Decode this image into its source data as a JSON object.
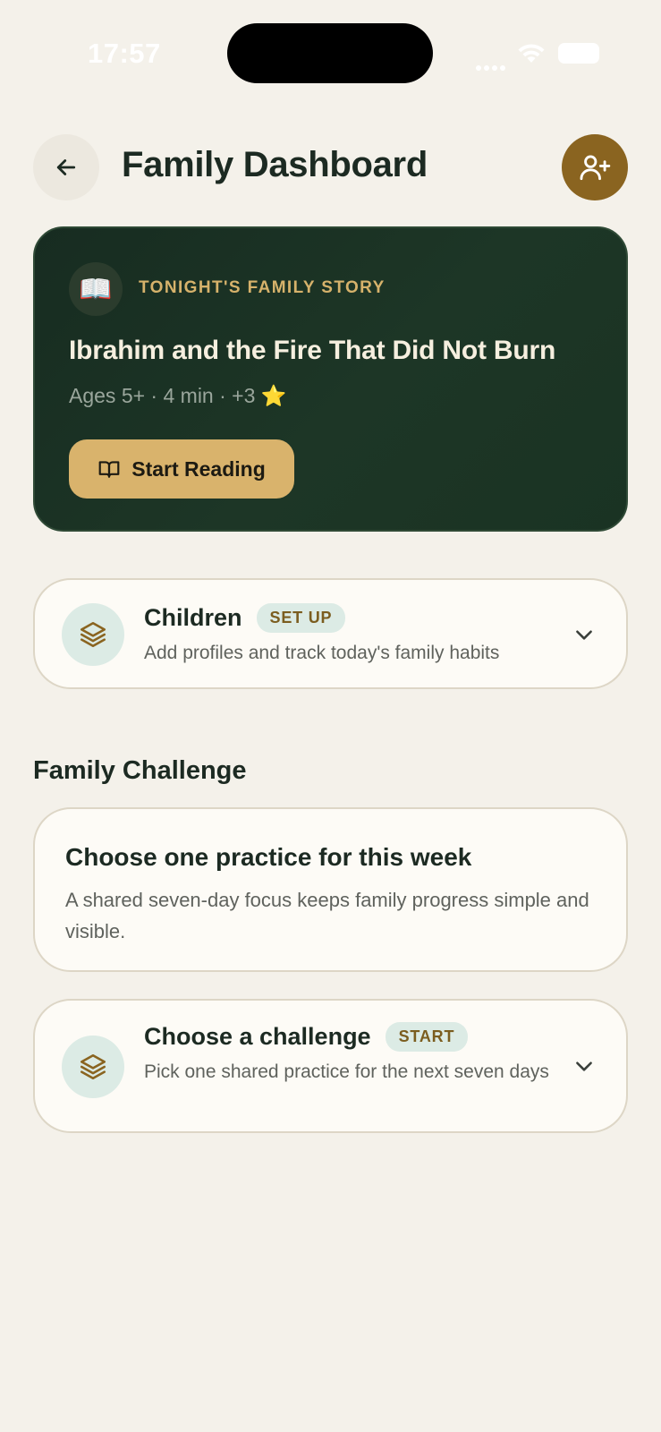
{
  "status_bar": {
    "time": "17:57"
  },
  "header": {
    "title": "Family Dashboard"
  },
  "story": {
    "eyebrow": "TONIGHT'S FAMILY STORY",
    "icon": "📖",
    "title": "Ibrahim and the Fire That Did Not Burn",
    "meta": "Ages 5+ · 4 min · +3 ⭐",
    "button_label": "Start Reading"
  },
  "children": {
    "title": "Children",
    "badge": "SET UP",
    "subtitle": "Add profiles and track today's family habits"
  },
  "family_challenge": {
    "section_title": "Family Challenge",
    "info_title": "Choose one practice for this week",
    "info_body": "A shared seven-day focus keeps family progress simple and visible.",
    "pick": {
      "title": "Choose a challenge",
      "badge": "START",
      "subtitle": "Pick one shared practice for the next seven days"
    }
  },
  "colors": {
    "background": "#f4f1ea",
    "story_card": "#1b3323",
    "accent_gold": "#d9b36c",
    "add_member_button": "#8a6420",
    "badge_bg": "#dcebe5"
  }
}
